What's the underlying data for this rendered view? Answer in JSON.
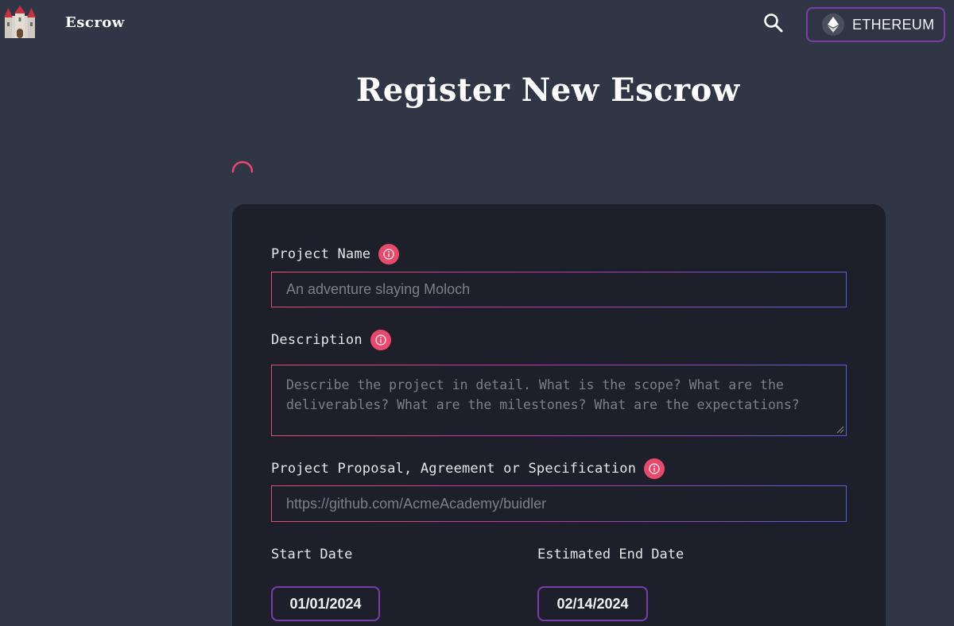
{
  "header": {
    "logo_icon": "castle-icon",
    "brand": "Escrow",
    "search_icon": "search-icon",
    "network": {
      "icon": "ethereum-icon",
      "label": "ETHEREUM"
    }
  },
  "page": {
    "title": "Register New Escrow"
  },
  "form": {
    "project_name": {
      "label": "Project Name",
      "placeholder": "An adventure slaying Moloch",
      "value": ""
    },
    "description": {
      "label": "Description",
      "placeholder": "Describe the project in detail. What is the scope? What are the deliverables? What are the milestones? What are the expectations?",
      "value": ""
    },
    "proposal_link": {
      "label": "Project Proposal, Agreement or Specification",
      "placeholder": "https://github.com/AcmeAcademy/buidler",
      "value": ""
    },
    "start_date": {
      "label": "Start Date",
      "value": "01/01/2024"
    },
    "end_date": {
      "label": "Estimated End Date",
      "value": "02/14/2024"
    }
  },
  "colors": {
    "background": "#303646",
    "card": "#1d202a",
    "accent_pink": "#e8496d",
    "accent_purple": "#7a3ea8"
  }
}
